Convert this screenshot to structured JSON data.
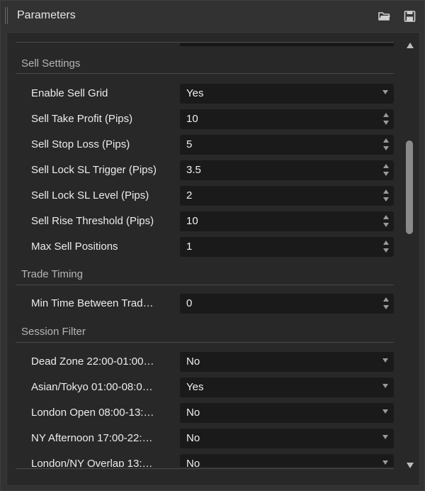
{
  "window": {
    "title": "Parameters"
  },
  "sections": [
    {
      "title": "Sell Settings"
    },
    {
      "title": "Trade Timing"
    },
    {
      "title": "Session Filter"
    }
  ],
  "rows": [
    {
      "label": "Enable Sell Grid",
      "value": "Yes",
      "kind": "dropdown"
    },
    {
      "label": "Sell Take Profit (Pips)",
      "value": "10",
      "kind": "spinner"
    },
    {
      "label": "Sell Stop Loss (Pips)",
      "value": "5",
      "kind": "spinner"
    },
    {
      "label": "Sell Lock SL Trigger (Pips)",
      "value": "3.5",
      "kind": "spinner"
    },
    {
      "label": "Sell Lock SL Level (Pips)",
      "value": "2",
      "kind": "spinner"
    },
    {
      "label": "Sell Rise Threshold (Pips)",
      "value": "10",
      "kind": "spinner"
    },
    {
      "label": "Max Sell Positions",
      "value": "1",
      "kind": "spinner"
    },
    {
      "label": "Min Time Between Trad…",
      "value": "0",
      "kind": "spinner"
    },
    {
      "label": "Dead Zone 22:00-01:00…",
      "value": "No",
      "kind": "dropdown"
    },
    {
      "label": "Asian/Tokyo 01:00-08:0…",
      "value": "Yes",
      "kind": "dropdown"
    },
    {
      "label": "London Open 08:00-13:…",
      "value": "No",
      "kind": "dropdown"
    },
    {
      "label": "NY Afternoon 17:00-22:…",
      "value": "No",
      "kind": "dropdown"
    },
    {
      "label": "London/NY Overlap 13:…",
      "value": "No",
      "kind": "dropdown"
    }
  ],
  "icons": {
    "open": "folder-open-icon",
    "save": "floppy-disk-icon"
  },
  "colors": {
    "panel_bg": "#323232",
    "list_bg": "#282828",
    "field_bg": "#1a1a1a",
    "text": "#ececec",
    "section_text": "#b5b5b5"
  }
}
